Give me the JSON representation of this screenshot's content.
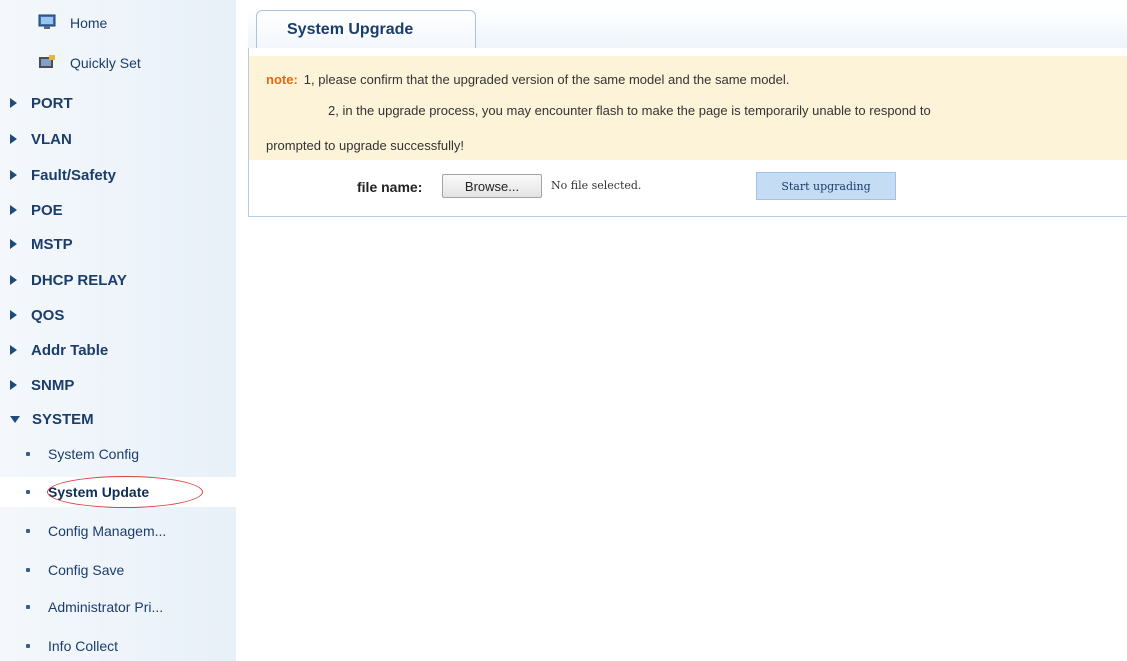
{
  "sidebar": {
    "apps": [
      {
        "label": "Home",
        "icon": "home-monitor-icon"
      },
      {
        "label": "Quickly Set",
        "icon": "quick-set-icon"
      }
    ],
    "groups": [
      {
        "label": "PORT"
      },
      {
        "label": "VLAN"
      },
      {
        "label": "Fault/Safety"
      },
      {
        "label": "POE"
      },
      {
        "label": "MSTP"
      },
      {
        "label": "DHCP RELAY"
      },
      {
        "label": "QOS"
      },
      {
        "label": "Addr Table"
      },
      {
        "label": "SNMP"
      },
      {
        "label": "SYSTEM"
      }
    ],
    "system_items": [
      {
        "label": "System Config"
      },
      {
        "label": "System Update"
      },
      {
        "label": "Config Managem..."
      },
      {
        "label": "Config Save"
      },
      {
        "label": "Administrator Pri..."
      },
      {
        "label": "Info Collect"
      }
    ],
    "active_item": "System Update"
  },
  "main": {
    "tab_label": "System Upgrade",
    "note": {
      "label": "note:",
      "line1": "1, please confirm that the upgraded version of the same model and the same model.",
      "line2": "2, in the upgrade process, you may encounter flash to make the page is temporarily unable to respond to",
      "line3": "prompted to upgrade successfully!"
    },
    "form": {
      "file_label": "file name:",
      "browse_label": "Browse...",
      "file_status": "No file selected.",
      "upgrade_label": "Start upgrading"
    }
  },
  "colors": {
    "note_bg": "#fdf3d8",
    "note_label": "#e06a10",
    "upgrade_button_bg": "#c4dcf4",
    "highlight_oval": "#d94040"
  }
}
